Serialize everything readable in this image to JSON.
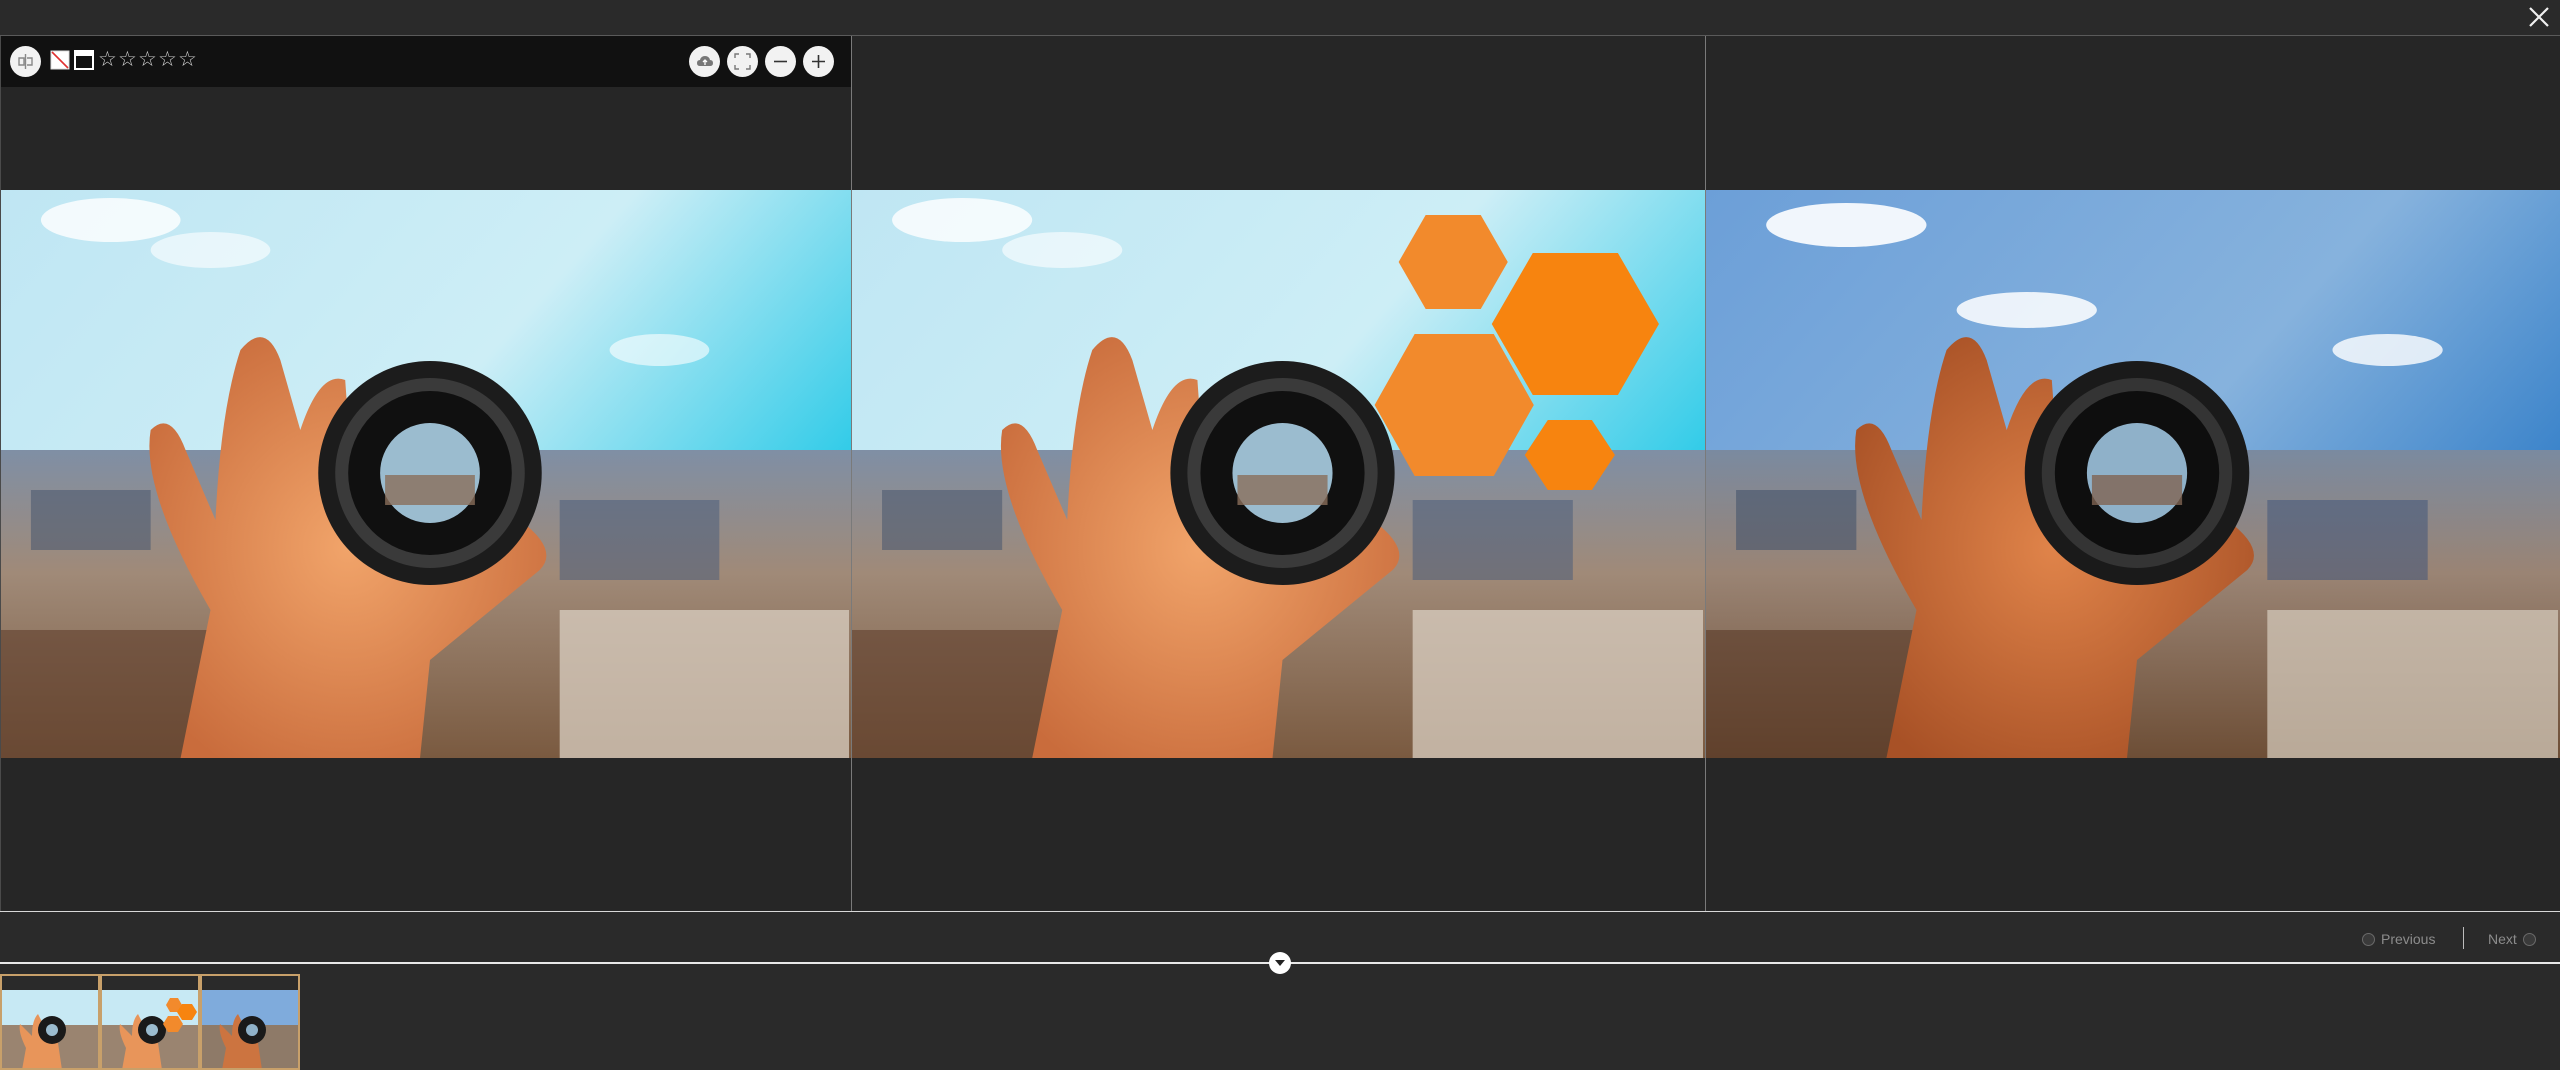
{
  "window": {
    "close_icon": "close-icon"
  },
  "toolbar": {
    "left_icons": [
      "compare-icon",
      "no-image-icon",
      "window-icon"
    ],
    "rating": {
      "stars_total": 5,
      "stars_filled": 0,
      "star_char": "☆"
    },
    "right_icons": [
      "cloud-upload-icon",
      "fullscreen-icon",
      "zoom-out-icon",
      "zoom-in-icon"
    ]
  },
  "panes": [
    {
      "name": "original"
    },
    {
      "name": "with-overlay",
      "overlay_color": "#f28a2c"
    },
    {
      "name": "edited"
    }
  ],
  "navigation": {
    "previous_label": "Previous",
    "next_label": "Next"
  },
  "filmstrip": {
    "count": 3,
    "border_color": "#c8a06a"
  },
  "colors": {
    "accent_orange": "#f5841f",
    "toolbar_bg": "#111111",
    "panel_bg": "#262626"
  }
}
